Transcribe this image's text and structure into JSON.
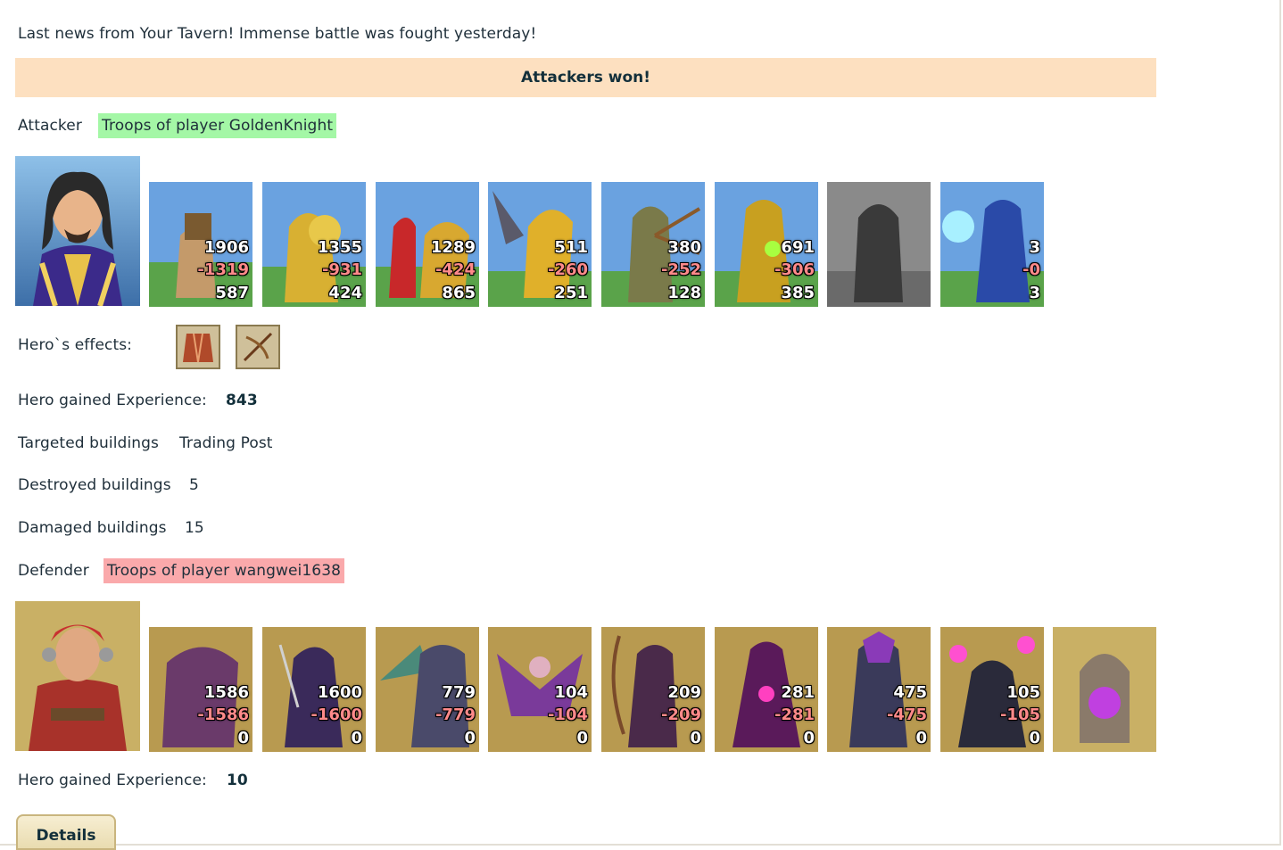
{
  "news": "Last news from Your Tavern! Immense battle was fought yesterday!",
  "result": "Attackers won!",
  "attacker": {
    "label": "Attacker",
    "name": "Troops of player GoldenKnight",
    "experience_label": "Hero gained Experience:",
    "experience": "843",
    "effects_label": "Hero`s effects:",
    "units": [
      {
        "start": "1906",
        "lost": "-1319",
        "left": "587"
      },
      {
        "start": "1355",
        "lost": "-931",
        "left": "424"
      },
      {
        "start": "1289",
        "lost": "-424",
        "left": "865"
      },
      {
        "start": "511",
        "lost": "-260",
        "left": "251"
      },
      {
        "start": "380",
        "lost": "-252",
        "left": "128"
      },
      {
        "start": "691",
        "lost": "-306",
        "left": "385"
      },
      {
        "start": "",
        "lost": "",
        "left": ""
      },
      {
        "start": "3",
        "lost": "-0",
        "left": "3"
      }
    ]
  },
  "buildings": {
    "targeted_label": "Targeted buildings",
    "targeted": "Trading Post",
    "destroyed_label": "Destroyed buildings",
    "destroyed": "5",
    "damaged_label": "Damaged buildings",
    "damaged": "15"
  },
  "defender": {
    "label": "Defender",
    "name": "Troops of player wangwei1638",
    "experience_label": "Hero gained Experience:",
    "experience": "10",
    "units": [
      {
        "start": "1586",
        "lost": "-1586",
        "left": "0"
      },
      {
        "start": "1600",
        "lost": "-1600",
        "left": "0"
      },
      {
        "start": "779",
        "lost": "-779",
        "left": "0"
      },
      {
        "start": "104",
        "lost": "-104",
        "left": "0"
      },
      {
        "start": "209",
        "lost": "-209",
        "left": "0"
      },
      {
        "start": "281",
        "lost": "-281",
        "left": "0"
      },
      {
        "start": "475",
        "lost": "-475",
        "left": "0"
      },
      {
        "start": "105",
        "lost": "-105",
        "left": "0"
      },
      {
        "start": "",
        "lost": "",
        "left": ""
      }
    ]
  },
  "details_button": "Details",
  "colors": {
    "banner": "#fde0c0",
    "attacker_tag": "#a4f7a6",
    "defender_tag": "#faa9ab",
    "loss_number": "#ff8a8a"
  },
  "icons": {
    "effect_1": "armor-effect-icon",
    "effect_2": "crossbow-effect-icon"
  }
}
